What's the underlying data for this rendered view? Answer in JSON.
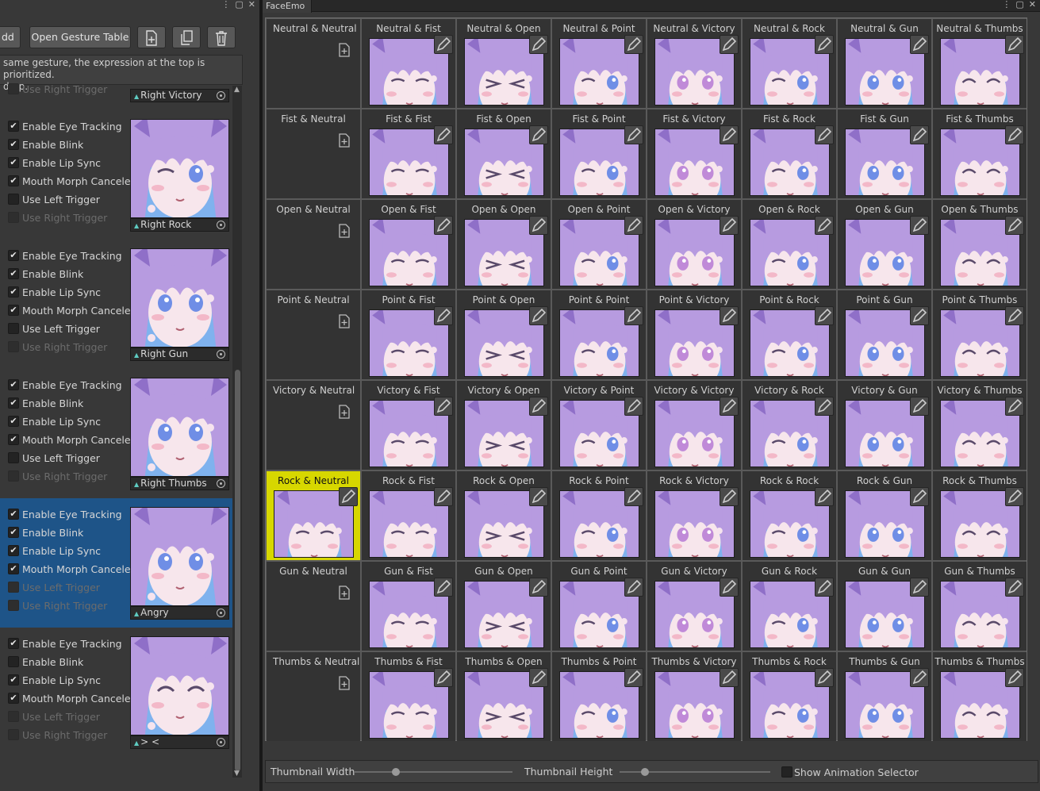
{
  "left_panel": {
    "toolbar": {
      "add_label": "dd",
      "open_gesture_table": "Open Gesture Table"
    },
    "notice": {
      "line1": "same gesture, the expression at the top is prioritized.",
      "line2": "drop."
    },
    "top_partial": {
      "option": "Use Right Trigger",
      "label": "Right Victory"
    },
    "entries": [
      {
        "name": "Right Rock",
        "selected": false,
        "options": [
          {
            "label": "Enable Eye Tracking",
            "checked": true,
            "disabled": false
          },
          {
            "label": "Enable Blink",
            "checked": true,
            "disabled": false
          },
          {
            "label": "Enable Lip Sync",
            "checked": true,
            "disabled": false
          },
          {
            "label": "Mouth Morph Canceler",
            "checked": true,
            "disabled": false
          },
          {
            "label": "Use Left Trigger",
            "checked": false,
            "disabled": false
          },
          {
            "label": "Use Right Trigger",
            "checked": false,
            "disabled": true
          }
        ]
      },
      {
        "name": "Right Gun",
        "selected": false,
        "options": [
          {
            "label": "Enable Eye Tracking",
            "checked": true,
            "disabled": false
          },
          {
            "label": "Enable Blink",
            "checked": true,
            "disabled": false
          },
          {
            "label": "Enable Lip Sync",
            "checked": true,
            "disabled": false
          },
          {
            "label": "Mouth Morph Canceler",
            "checked": true,
            "disabled": false
          },
          {
            "label": "Use Left Trigger",
            "checked": false,
            "disabled": false
          },
          {
            "label": "Use Right Trigger",
            "checked": false,
            "disabled": true
          }
        ]
      },
      {
        "name": "Right Thumbs",
        "selected": false,
        "options": [
          {
            "label": "Enable Eye Tracking",
            "checked": true,
            "disabled": false
          },
          {
            "label": "Enable Blink",
            "checked": true,
            "disabled": false
          },
          {
            "label": "Enable Lip Sync",
            "checked": true,
            "disabled": false
          },
          {
            "label": "Mouth Morph Canceler",
            "checked": true,
            "disabled": false
          },
          {
            "label": "Use Left Trigger",
            "checked": false,
            "disabled": false
          },
          {
            "label": "Use Right Trigger",
            "checked": false,
            "disabled": true
          }
        ]
      },
      {
        "name": "Angry",
        "selected": true,
        "options": [
          {
            "label": "Enable Eye Tracking",
            "checked": true,
            "disabled": false
          },
          {
            "label": "Enable Blink",
            "checked": true,
            "disabled": false
          },
          {
            "label": "Enable Lip Sync",
            "checked": true,
            "disabled": false
          },
          {
            "label": "Mouth Morph Canceler",
            "checked": true,
            "disabled": false
          },
          {
            "label": "Use Left Trigger",
            "checked": false,
            "disabled": true
          },
          {
            "label": "Use Right Trigger",
            "checked": false,
            "disabled": true
          }
        ]
      },
      {
        "name": "> <",
        "selected": false,
        "options": [
          {
            "label": "Enable Eye Tracking",
            "checked": true,
            "disabled": false
          },
          {
            "label": "Enable Blink",
            "checked": false,
            "disabled": false
          },
          {
            "label": "Enable Lip Sync",
            "checked": true,
            "disabled": false
          },
          {
            "label": "Mouth Morph Canceler",
            "checked": true,
            "disabled": false
          },
          {
            "label": "Use Left Trigger",
            "checked": false,
            "disabled": true
          },
          {
            "label": "Use Right Trigger",
            "checked": false,
            "disabled": true
          }
        ]
      }
    ]
  },
  "right_panel": {
    "tab_title": "FaceEmo",
    "gestures": [
      "Neutral",
      "Fist",
      "Open",
      "Point",
      "Victory",
      "Rock",
      "Gun",
      "Thumbs"
    ],
    "separator": " & ",
    "highlighted": "Rock & Neutral",
    "bottom": {
      "thumb_width": "Thumbnail Width",
      "thumb_height": "Thumbnail Height",
      "show_selector": "Show Animation Selector",
      "width_value": 0.26,
      "height_value": 0.17
    }
  },
  "colors": {
    "hair": "#b79be0",
    "hair_dark": "#8f6fc8",
    "skin": "#f7e6ec",
    "bg_sky": "#7fb2ee",
    "highlight": "#d7d700",
    "selection": "#1e5488"
  }
}
